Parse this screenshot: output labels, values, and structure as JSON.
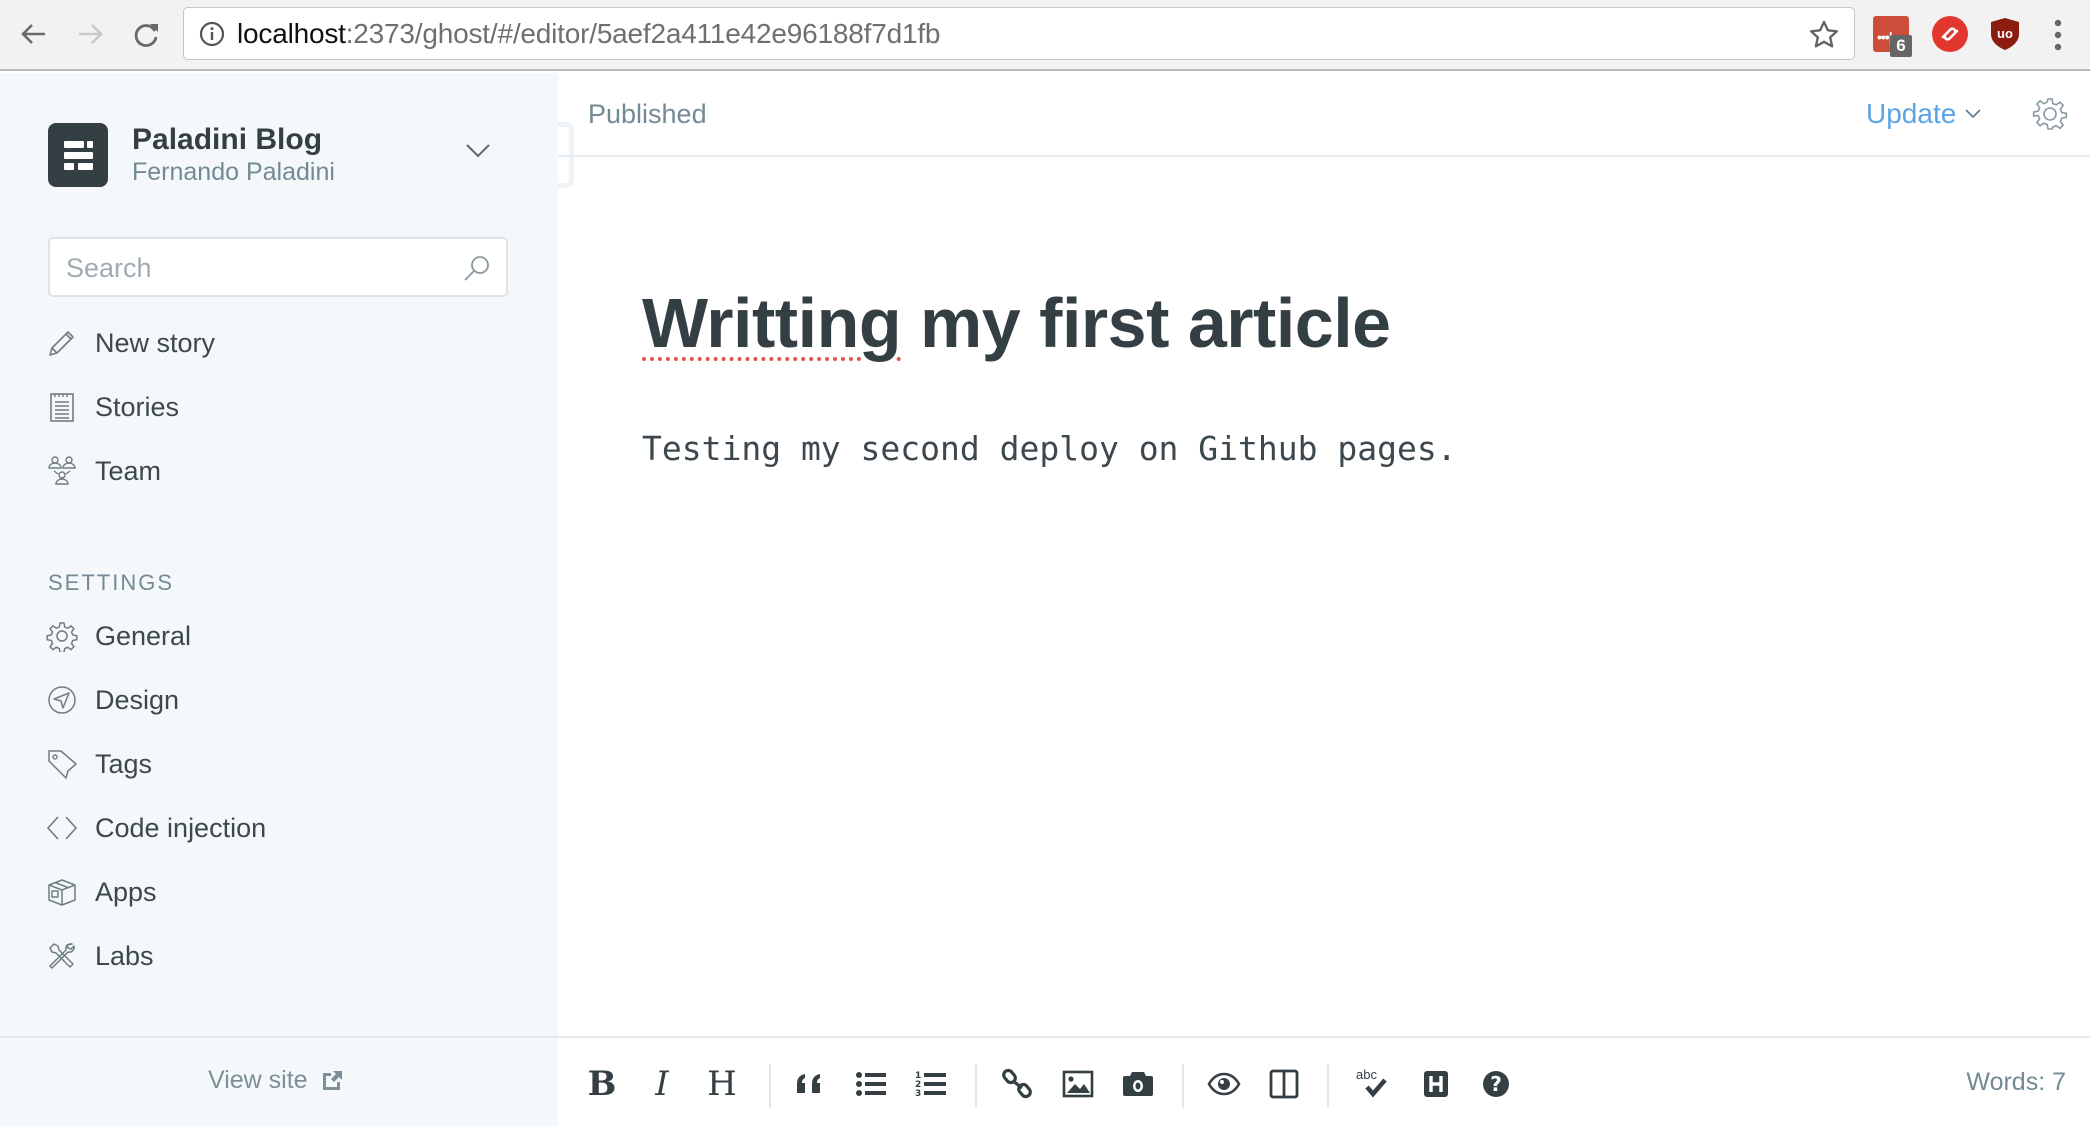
{
  "browser": {
    "url_host": "localhost",
    "url_path": ":2373/ghost/#/editor/5aef2a411e42e96188f7d1fb",
    "extension_badge": "6",
    "icons": [
      "back-icon",
      "forward-icon",
      "reload-icon",
      "info-icon",
      "star-icon",
      "lastpass-icon",
      "authy-icon",
      "ublock-icon",
      "menu-icon"
    ]
  },
  "sidebar": {
    "blog_title": "Paladini Blog",
    "blog_user": "Fernando Paladini",
    "search_placeholder": "Search",
    "nav": [
      {
        "label": "New story",
        "icon": "pencil-icon"
      },
      {
        "label": "Stories",
        "icon": "notepad-icon"
      },
      {
        "label": "Team",
        "icon": "team-icon"
      }
    ],
    "settings_label": "SETTINGS",
    "settings": [
      {
        "label": "General",
        "icon": "gear-icon"
      },
      {
        "label": "Design",
        "icon": "compass-icon"
      },
      {
        "label": "Tags",
        "icon": "tag-icon"
      },
      {
        "label": "Code injection",
        "icon": "code-icon"
      },
      {
        "label": "Apps",
        "icon": "box-icon"
      },
      {
        "label": "Labs",
        "icon": "tools-icon"
      }
    ],
    "view_site": "View site"
  },
  "editor": {
    "status": "Published",
    "update_label": "Update",
    "title_misspelled": "Writting",
    "title_rest": " my first article",
    "body": "Testing my second deploy on Github pages.",
    "toolbar": {
      "bold": "B",
      "italic": "I",
      "heading": "H",
      "spell_label": "abc",
      "word_count": "Words: 7"
    },
    "accent_color": "#5ba4e5"
  }
}
